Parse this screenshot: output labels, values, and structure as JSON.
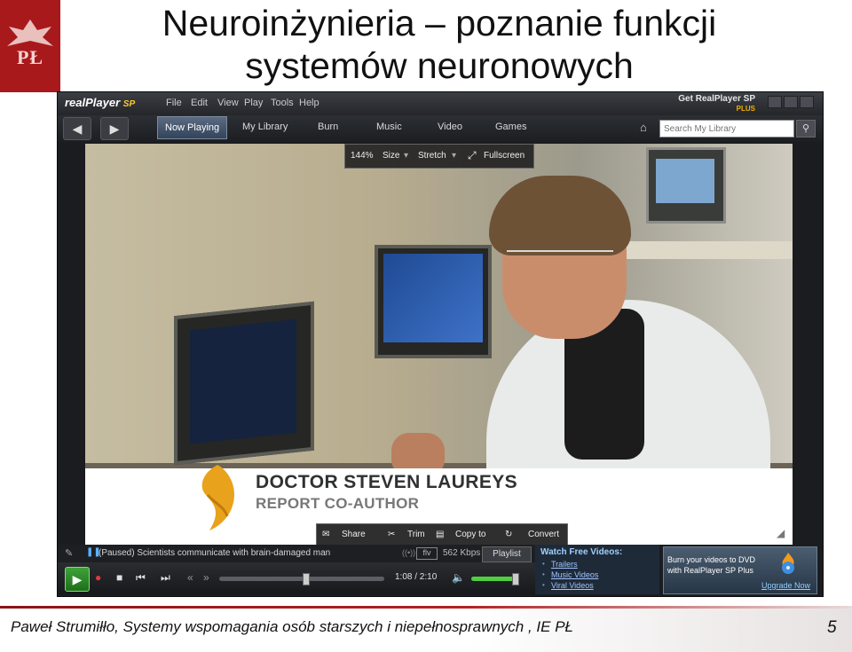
{
  "slide": {
    "title_line1": "Neuroinżynieria – poznanie funkcji",
    "title_line2": "systemów neuronowych",
    "logo_text": "PŁ",
    "footer": "Paweł Strumiłło, Systemy wspomagania osób  starszych i niepełnosprawnych , IE PŁ",
    "page_number": "5"
  },
  "player": {
    "brand": "realPlayer",
    "brand_suffix": "SP",
    "menu": [
      "File",
      "Edit",
      "View",
      "Play",
      "Tools",
      "Help"
    ],
    "get_plus_line1": "Get RealPlayer SP",
    "get_plus_line2": "PLUS",
    "tabs": [
      {
        "label": "Now Playing",
        "active": true
      },
      {
        "label": "My Library",
        "active": false
      },
      {
        "label": "Burn",
        "active": false
      },
      {
        "label": "Music",
        "active": false
      },
      {
        "label": "Video",
        "active": false
      },
      {
        "label": "Games",
        "active": false
      }
    ],
    "search_placeholder": "Search My Library",
    "video_tools": {
      "zoom": "144%",
      "size": "Size",
      "stretch": "Stretch",
      "fullscreen": "Fullscreen"
    },
    "share_tools": {
      "share": "Share",
      "trim": "Trim",
      "copy_to": "Copy to",
      "convert": "Convert"
    },
    "lower_third": {
      "name": "DOCTOR STEVEN LAUREYS",
      "role": "REPORT CO-AUTHOR"
    },
    "status": "(Paused) Scientists communicate with brain-damaged man",
    "format": "flv",
    "bitrate": "562 Kbps",
    "playlist_label": "Playlist",
    "time": "1:08 / 2:10",
    "seek_fraction": 0.52,
    "volume_fraction": 0.9,
    "watch_title": "Watch Free Videos:",
    "watch_links": [
      "Trailers",
      "Music Videos",
      "Viral Videos"
    ],
    "dvd_text": "Burn your videos to DVD with RealPlayer SP Plus",
    "upgrade": "Upgrade Now",
    "accent": "#4fcf3f"
  }
}
